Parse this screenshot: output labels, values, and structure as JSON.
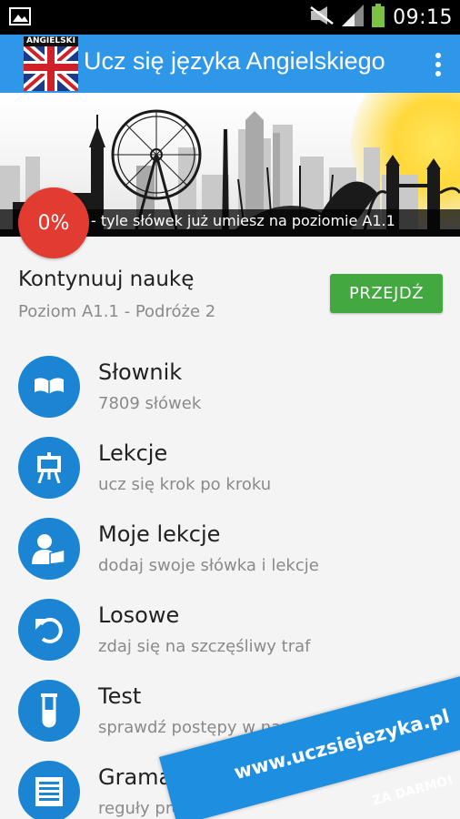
{
  "status_bar": {
    "time": "09:15",
    "icons": [
      "picture-icon",
      "mute-icon",
      "signal-icon",
      "battery-icon"
    ]
  },
  "app_bar": {
    "logo_text": "ANGIELSKI",
    "title": "Ucz się języka Angielskiego",
    "menu_icon": "overflow-menu-icon",
    "color": "#2f97e8"
  },
  "banner": {
    "progress_percent": "0%",
    "progress_text": "- tyle słówek już umiesz na poziomie A1.1",
    "badge_color": "#e23b32"
  },
  "continue": {
    "title": "Kontynuuj naukę",
    "subtitle": "Poziom A1.1 - Podróże 2",
    "button_label": "PRZEJDŹ",
    "button_color": "#43a83f"
  },
  "menu": {
    "accent_color": "#1b84d3",
    "items": [
      {
        "title": "Słownik",
        "subtitle": "7809 słówek",
        "icon": "book-icon"
      },
      {
        "title": "Lekcje",
        "subtitle": "ucz się krok po kroku",
        "icon": "easel-icon"
      },
      {
        "title": "Moje lekcje",
        "subtitle": "dodaj swoje słówka i lekcje",
        "icon": "user-book-icon"
      },
      {
        "title": "Losowe",
        "subtitle": "zdaj się na szczęśliwy traf",
        "icon": "undo-arrow-icon"
      },
      {
        "title": "Test",
        "subtitle": "sprawdź postępy w nauce",
        "icon": "test-tube-icon"
      },
      {
        "title": "Gramatyka",
        "subtitle": "reguły proste",
        "icon": "document-list-icon"
      }
    ]
  },
  "promo": {
    "url": "www.uczsiejezyka.pl",
    "tagline": "ZA DARMO!"
  }
}
